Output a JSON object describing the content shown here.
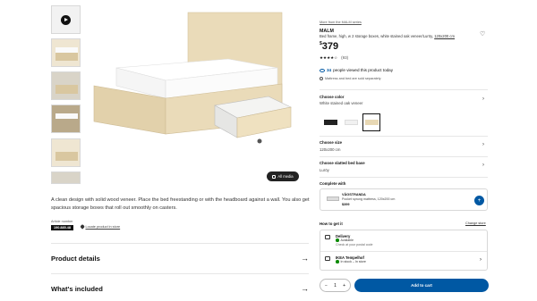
{
  "gallery": {
    "all_media_label": "All media"
  },
  "product": {
    "more_link": "More from the MALM series",
    "name": "MALM",
    "description": "Bed frame, high, w 2 storage boxes, white stained oak veneer/Luröy,",
    "size_link": "120x200 cm",
    "currency": "$",
    "price": "379",
    "stars": "★★★★☆",
    "rating_count": "(93)",
    "viewers_count": "34",
    "viewers_text": "people viewed this product today",
    "warranty": "Mattress and bed are sold separately",
    "long_description": "A clean design with solid wood veneer. Place the bed freestanding or with the headboard against a wall. You also get spacious storage boxes that roll out smoothly on casters.",
    "article_label": "Article number",
    "article_number": "190.885.48",
    "location_link": "Locate product in store"
  },
  "accordions": {
    "details": "Product details",
    "included": "What's included"
  },
  "options": {
    "color_label": "Choose color",
    "color_value": "White stained oak veneer",
    "size_label": "Choose size",
    "size_value": "120x200 cm",
    "base_label": "Choose slatted bed base",
    "base_value": "Luröy"
  },
  "complete": {
    "label": "Complete with",
    "name": "VÅGSTRANDA",
    "desc": "Pocket sprung mattress, 120x200 cm",
    "price": "$399",
    "add_icon": "bag-add-icon"
  },
  "get_it": {
    "label": "How to get it",
    "change_store": "Change store",
    "delivery_title": "Delivery",
    "delivery_status": "Available",
    "delivery_sub": "Check at your postal code",
    "store_title": "IKEA Tempelhof",
    "store_status": "In stock – In store"
  },
  "cart": {
    "minus": "−",
    "qty": "1",
    "plus": "+",
    "add_label": "Add to cart"
  },
  "colors": {
    "accent": "#0058a3",
    "stock_green": "#0a8a00",
    "oak": "#e8d8b4"
  }
}
